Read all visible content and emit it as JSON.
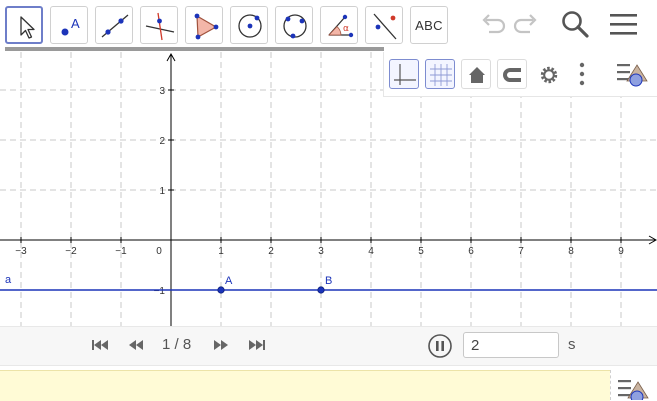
{
  "toolbar": {
    "tools": [
      {
        "name": "move-tool",
        "icon": "arrow-cursor-icon"
      },
      {
        "name": "point-tool",
        "icon": "point-icon",
        "label": "A"
      },
      {
        "name": "line-tool",
        "icon": "line-through-points-icon"
      },
      {
        "name": "perpendicular-tool",
        "icon": "perpendicular-line-icon"
      },
      {
        "name": "polygon-tool",
        "icon": "polygon-icon"
      },
      {
        "name": "circle-tool",
        "icon": "circle-center-point-icon"
      },
      {
        "name": "conic-tool",
        "icon": "circle-three-points-icon"
      },
      {
        "name": "angle-tool",
        "icon": "angle-icon",
        "label": "α"
      },
      {
        "name": "reflect-tool",
        "icon": "reflect-about-line-icon"
      },
      {
        "name": "text-tool",
        "icon": "text-icon",
        "label": "ABC"
      }
    ],
    "undo_icon": "undo-icon",
    "redo_icon": "redo-icon",
    "search_icon": "search-icon",
    "menu_icon": "hamburger-menu-icon"
  },
  "style_bar": {
    "buttons": [
      "axes-icon",
      "grid-icon",
      "home-icon",
      "magnet-icon",
      "gear-icon",
      "more-icon"
    ],
    "toggle_icon": "toggle-style-bar-icon"
  },
  "graph": {
    "x_ticks": [
      "−3",
      "−2",
      "−1",
      "0",
      "1",
      "2",
      "3",
      "4",
      "5",
      "6",
      "7",
      "8",
      "9"
    ],
    "y_ticks": [
      "3",
      "2",
      "1",
      "−1"
    ],
    "line_label": "a",
    "points": [
      {
        "label": "A",
        "x": 1,
        "y": -1
      },
      {
        "label": "B",
        "x": 3,
        "y": -1
      }
    ],
    "colors": {
      "object": "#1c34b9",
      "grid": "#c8c8c8",
      "axis": "#000000"
    }
  },
  "animation": {
    "slide_counter": "1 / 8",
    "speed_value": "2",
    "speed_unit": "s"
  }
}
